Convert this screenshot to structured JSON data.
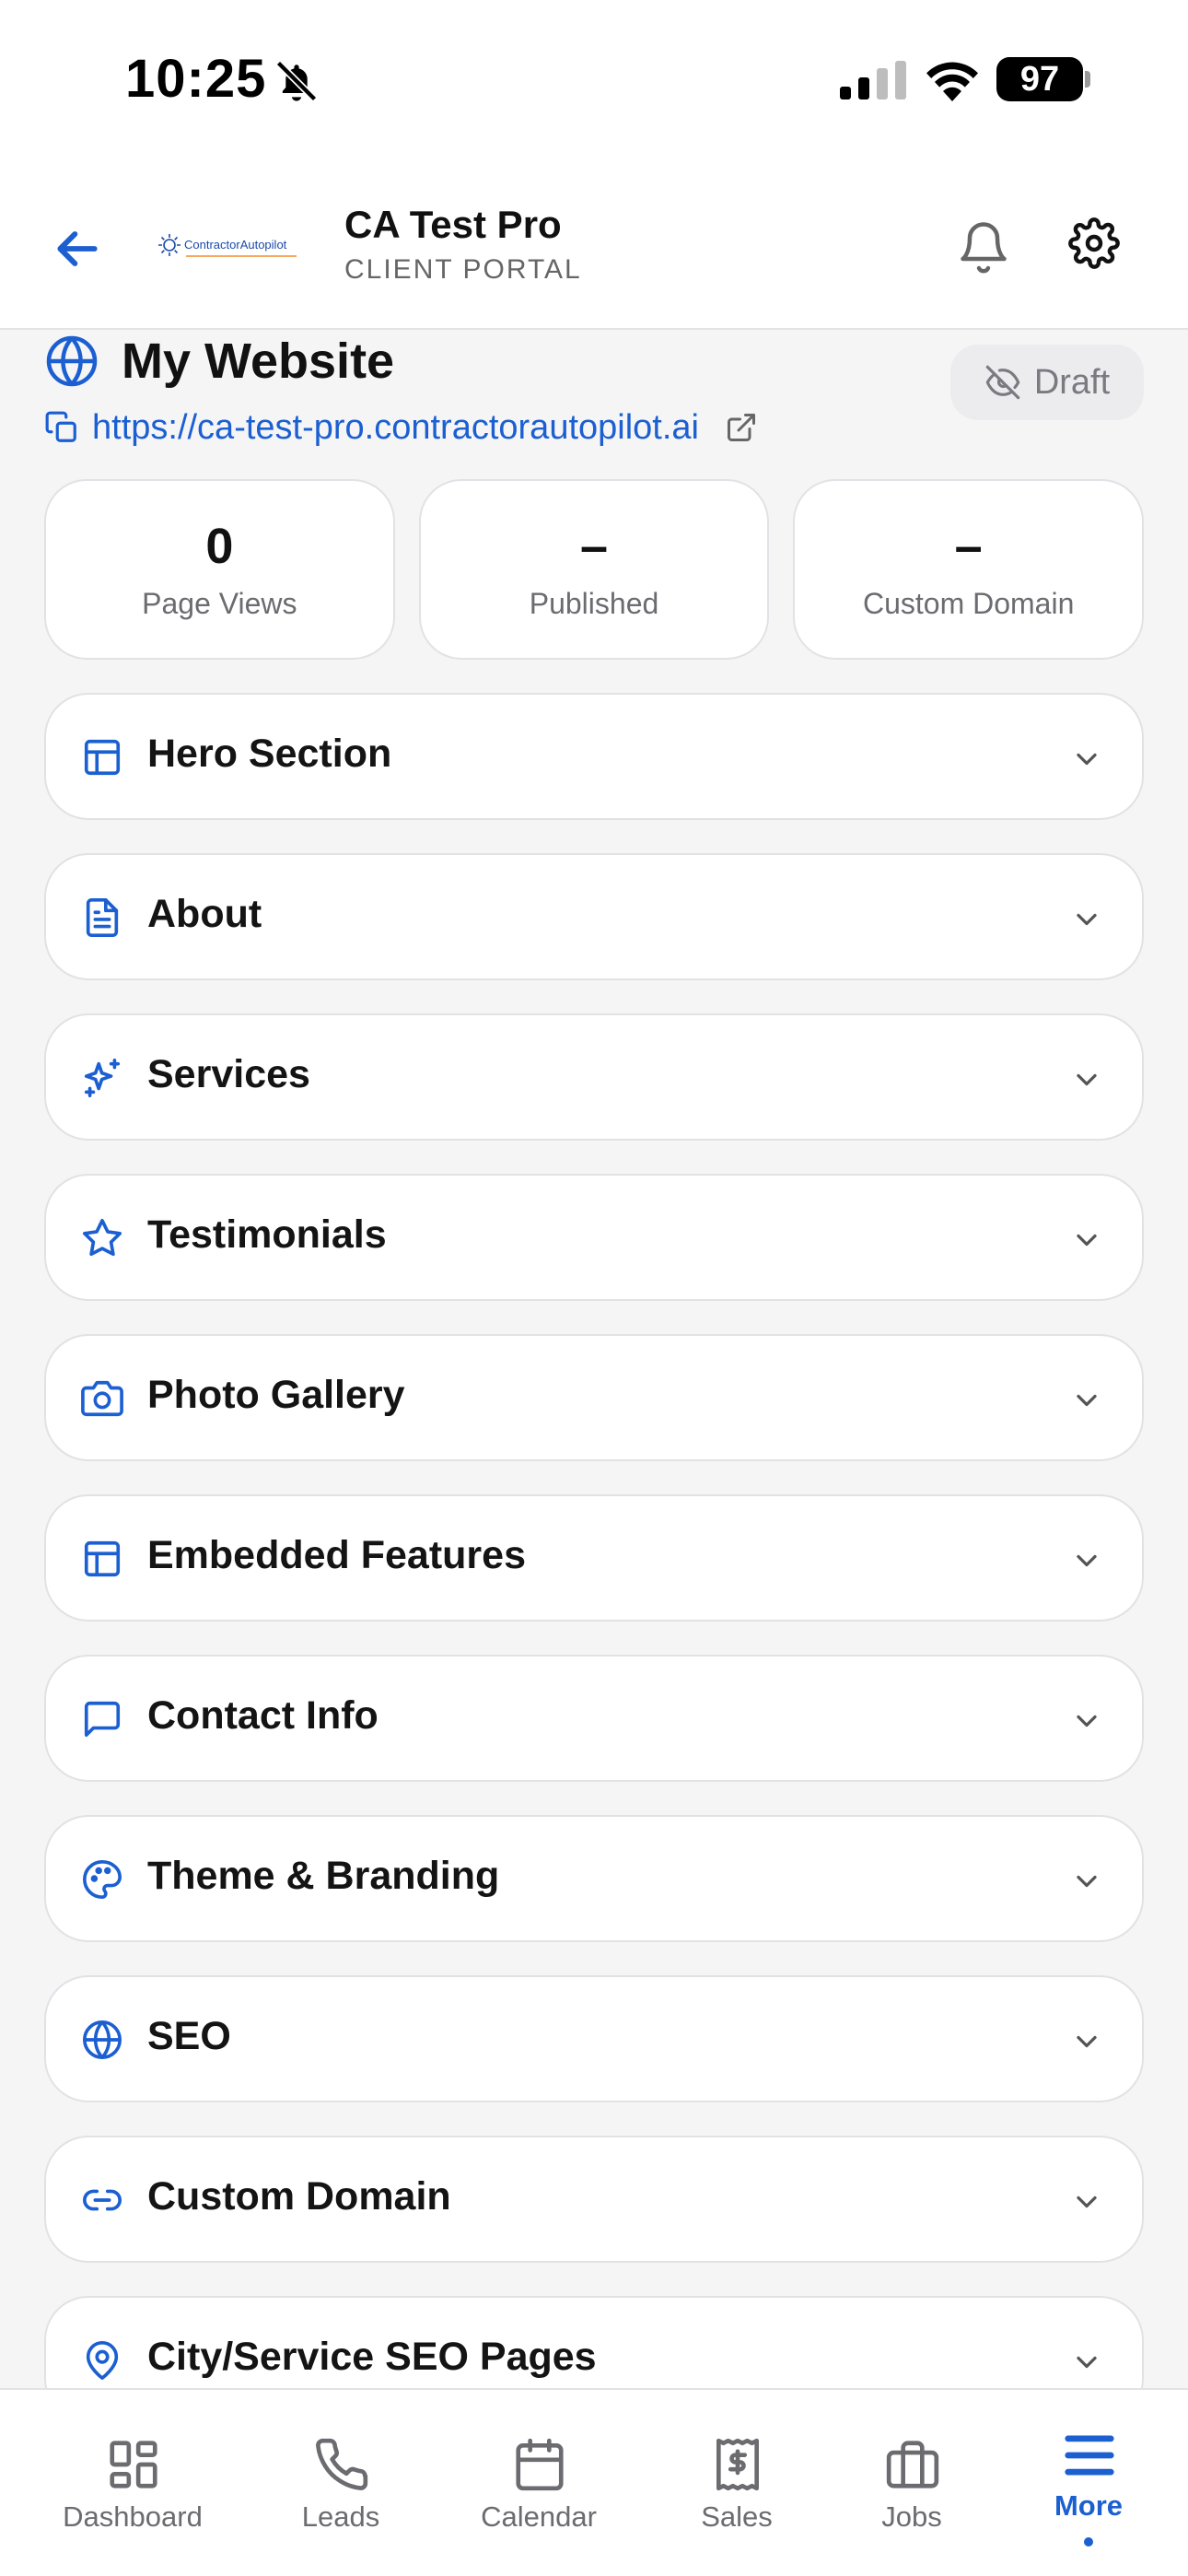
{
  "status_bar": {
    "time": "10:25",
    "battery": "97"
  },
  "header": {
    "back_label": "Back",
    "logo_text": "ContractorAutopilot",
    "title": "CA Test Pro",
    "subtitle": "CLIENT PORTAL"
  },
  "website": {
    "title": "My Website",
    "status": "Draft",
    "url": "https://ca-test-pro.contractorautopilot.ai"
  },
  "stats": [
    {
      "value": "0",
      "label": "Page Views"
    },
    {
      "value": "–",
      "label": "Published"
    },
    {
      "value": "–",
      "label": "Custom Domain"
    }
  ],
  "sections": [
    {
      "label": "Hero Section",
      "icon": "layout-icon"
    },
    {
      "label": "About",
      "icon": "document-icon"
    },
    {
      "label": "Services",
      "icon": "sparkles-icon"
    },
    {
      "label": "Testimonials",
      "icon": "star-icon"
    },
    {
      "label": "Photo Gallery",
      "icon": "camera-icon"
    },
    {
      "label": "Embedded Features",
      "icon": "layout-icon"
    },
    {
      "label": "Contact Info",
      "icon": "message-icon"
    },
    {
      "label": "Theme & Branding",
      "icon": "palette-icon"
    },
    {
      "label": "SEO",
      "icon": "globe-icon"
    },
    {
      "label": "Custom Domain",
      "icon": "link-icon"
    },
    {
      "label": "City/Service SEO Pages",
      "icon": "map-pin-icon"
    }
  ],
  "tabs": [
    {
      "label": "Dashboard",
      "icon": "dashboard-icon"
    },
    {
      "label": "Leads",
      "icon": "phone-icon"
    },
    {
      "label": "Calendar",
      "icon": "calendar-icon"
    },
    {
      "label": "Sales",
      "icon": "receipt-icon"
    },
    {
      "label": "Jobs",
      "icon": "briefcase-icon"
    },
    {
      "label": "More",
      "icon": "menu-icon",
      "active": true
    }
  ],
  "colors": {
    "accent": "#1b5fd1",
    "text": "#141414",
    "muted": "#6b6b70",
    "background": "#f5f5f6"
  }
}
